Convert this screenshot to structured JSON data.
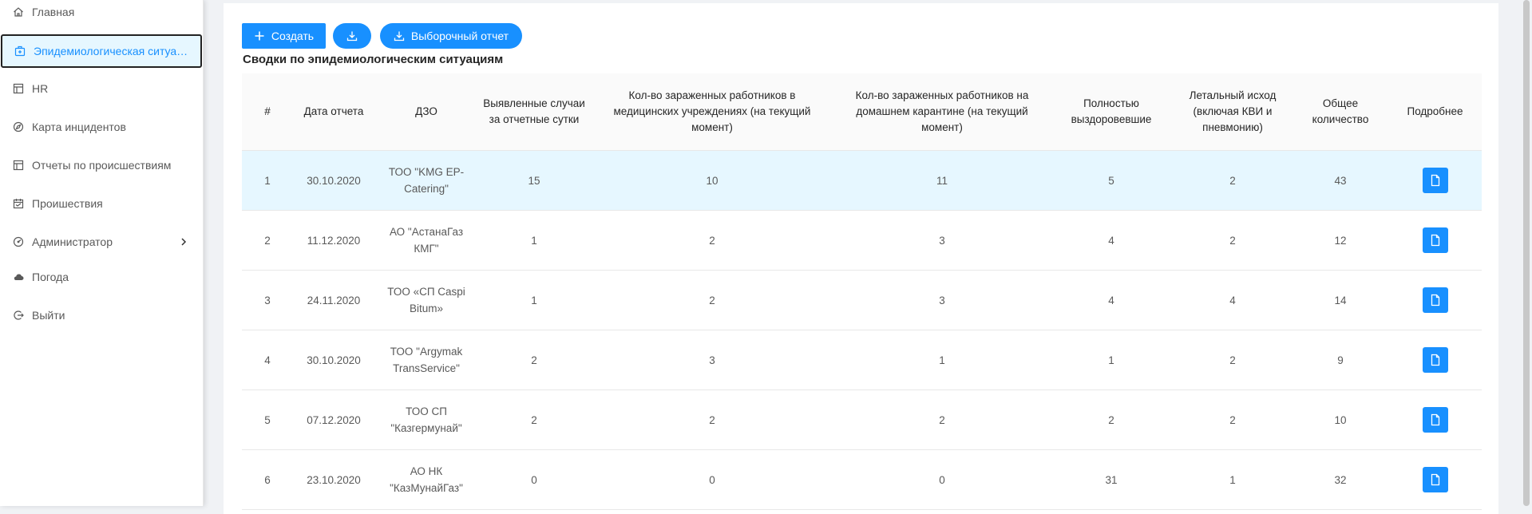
{
  "sidebar": {
    "items": [
      {
        "label": "Главная",
        "icon": "home-icon"
      },
      {
        "label": "Эпидемиологическая ситуация",
        "icon": "medical-box-icon"
      },
      {
        "label": "HR",
        "icon": "layout-icon"
      },
      {
        "label": "Карта инцидентов",
        "icon": "compass-icon"
      },
      {
        "label": "Отчеты по происшествиям",
        "icon": "layout-icon"
      },
      {
        "label": "Проишествия",
        "icon": "calendar-icon"
      },
      {
        "label": "Администратор",
        "icon": "dashboard-icon"
      },
      {
        "label": "Погода",
        "icon": "cloud-icon"
      },
      {
        "label": "Выйти",
        "icon": "logout-icon"
      }
    ]
  },
  "toolbar": {
    "create_label": "Создать",
    "report_label": "Выборочный отчет"
  },
  "section_title": "Сводки по эпидемиологическим ситуациям",
  "table": {
    "headers": [
      "#",
      "Дата отчета",
      "ДЗО",
      "Выявленные случаи за отчетные сутки",
      "Кол-во зараженных работников в медицинских учреждениях (на текущий момент)",
      "Кол-во зараженных работников на домашнем карантине (на текущий момент)",
      "Полностью выздоровевшие",
      "Летальный исход (включая КВИ и пневмонию)",
      "Общее количество",
      "Подробнее"
    ],
    "rows": [
      [
        "1",
        "30.10.2020",
        "ТОО \"KMG EP-Catering\"",
        "15",
        "10",
        "11",
        "5",
        "2",
        "43"
      ],
      [
        "2",
        "11.12.2020",
        "АО \"АстанаГаз КМГ\"",
        "1",
        "2",
        "3",
        "4",
        "2",
        "12"
      ],
      [
        "3",
        "24.11.2020",
        "ТОО «СП Caspi Bitum»",
        "1",
        "2",
        "3",
        "4",
        "4",
        "14"
      ],
      [
        "4",
        "30.10.2020",
        "ТОО \"Argymak TransService\"",
        "2",
        "3",
        "1",
        "1",
        "2",
        "9"
      ],
      [
        "5",
        "07.12.2020",
        "ТОО СП \"Казгермунай\"",
        "2",
        "2",
        "2",
        "2",
        "2",
        "10"
      ],
      [
        "6",
        "23.10.2020",
        "АО НК \"КазМунайГаз\"",
        "0",
        "0",
        "0",
        "31",
        "1",
        "32"
      ]
    ]
  },
  "colors": {
    "primary": "#1890ff",
    "row_highlight": "#e6f7ff",
    "background": "#f0f2f5"
  }
}
